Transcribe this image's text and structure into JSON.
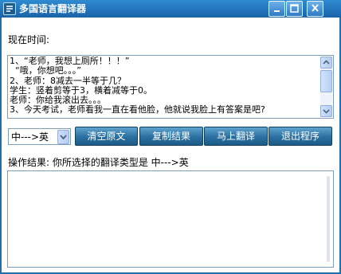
{
  "window": {
    "title": "多国语言翻译器",
    "controls": {
      "minimize_icon": "minimize-icon",
      "maximize_icon": "maximize-icon",
      "close_icon": "close-icon"
    }
  },
  "time": {
    "label": "现在时间:"
  },
  "source_text": {
    "lines": [
      "1、“老师，我想上厕所！！！”",
      "  “哦，你想吧。。。”",
      "2、老师：8减去一半等于几？",
      "学生：竖着剪等于3，横着减等于0。",
      "老师：你给我滚出去。。。",
      "3、今天考试，老师看我一直在看他脸，他就说我脸上有答案是吧?"
    ]
  },
  "direction_select": {
    "value": "中--->英"
  },
  "buttons": {
    "clear": "清空原文",
    "copy": "复制结果",
    "translate": "马上翻译",
    "exit": "退出程序"
  },
  "result": {
    "label": "操作结果: 你所选择的翻译类型是   中--->英",
    "text": ""
  },
  "colors": {
    "titlebar": "#1f6fae",
    "button": "#2a6f9f",
    "border": "#7f9db9"
  }
}
